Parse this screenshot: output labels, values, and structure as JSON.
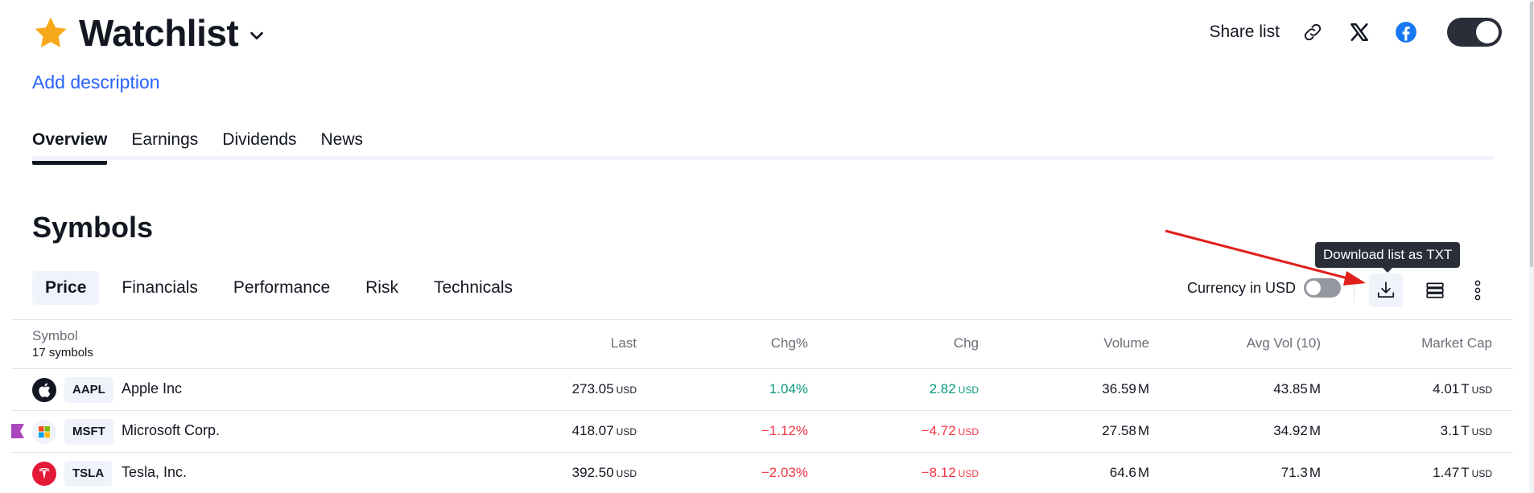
{
  "header": {
    "title": "Watchlist",
    "add_description": "Add description",
    "share_label": "Share list"
  },
  "tabs": [
    {
      "label": "Overview",
      "active": true
    },
    {
      "label": "Earnings",
      "active": false
    },
    {
      "label": "Dividends",
      "active": false
    },
    {
      "label": "News",
      "active": false
    }
  ],
  "section_title": "Symbols",
  "subtabs": [
    {
      "label": "Price",
      "active": true
    },
    {
      "label": "Financials",
      "active": false
    },
    {
      "label": "Performance",
      "active": false
    },
    {
      "label": "Risk",
      "active": false
    },
    {
      "label": "Technicals",
      "active": false
    }
  ],
  "toolbar": {
    "currency_label": "Currency in USD",
    "currency_toggle_on": false,
    "tooltip": "Download list as TXT"
  },
  "table": {
    "symbol_header": "Symbol",
    "symbol_count": "17 symbols",
    "columns": [
      "Last",
      "Chg%",
      "Chg",
      "Volume",
      "Avg Vol (10)",
      "Market Cap"
    ],
    "rows": [
      {
        "ticker": "AAPL",
        "name": "Apple Inc",
        "last": "273.05",
        "last_unit": "USD",
        "chg_pct": "1.04%",
        "chg": "2.82",
        "chg_unit": "USD",
        "volume": "36.59",
        "volume_unit": "M",
        "avg_vol": "43.85",
        "avg_vol_unit": "M",
        "mcap": "4.01",
        "mcap_unit": "T",
        "mcap_cur": "USD",
        "direction": "up"
      },
      {
        "ticker": "MSFT",
        "name": "Microsoft Corp.",
        "last": "418.07",
        "last_unit": "USD",
        "chg_pct": "−1.12%",
        "chg": "−4.72",
        "chg_unit": "USD",
        "volume": "27.58",
        "volume_unit": "M",
        "avg_vol": "34.92",
        "avg_vol_unit": "M",
        "mcap": "3.1",
        "mcap_unit": "T",
        "mcap_cur": "USD",
        "direction": "down"
      },
      {
        "ticker": "TSLA",
        "name": "Tesla, Inc.",
        "last": "392.50",
        "last_unit": "USD",
        "chg_pct": "−2.03%",
        "chg": "−8.12",
        "chg_unit": "USD",
        "volume": "64.6",
        "volume_unit": "M",
        "avg_vol": "71.3",
        "avg_vol_unit": "M",
        "mcap": "1.47",
        "mcap_unit": "T",
        "mcap_cur": "USD",
        "direction": "down"
      }
    ]
  },
  "colors": {
    "accent_link": "#2962ff",
    "positive": "#089981",
    "negative": "#f23645",
    "annotation_arrow": "#e0201b"
  }
}
